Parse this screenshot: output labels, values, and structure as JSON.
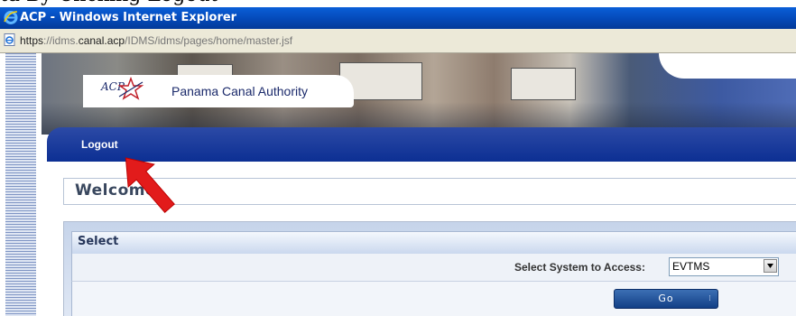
{
  "doc_text": "ta By Clicking Logout",
  "window": {
    "title": "ACP - Windows Internet Explorer",
    "url_scheme": "https",
    "url_host_pre": "://idms.",
    "url_host": "canal.acp",
    "url_path": "/IDMS/idms/pages/home/master.jsf"
  },
  "banner": {
    "logo_text": "ACP",
    "brand": "Panama Canal Authority"
  },
  "nav": {
    "logout_label": "Logout"
  },
  "content": {
    "welcome": "Welcome",
    "select_title": "Select",
    "access_label": "Select System to Access:",
    "system_value": "EVTMS",
    "go_label": "Go"
  },
  "colors": {
    "titlebar": "#0449b8",
    "navbar": "#0c2f93",
    "arrow": "#e21b1b"
  }
}
